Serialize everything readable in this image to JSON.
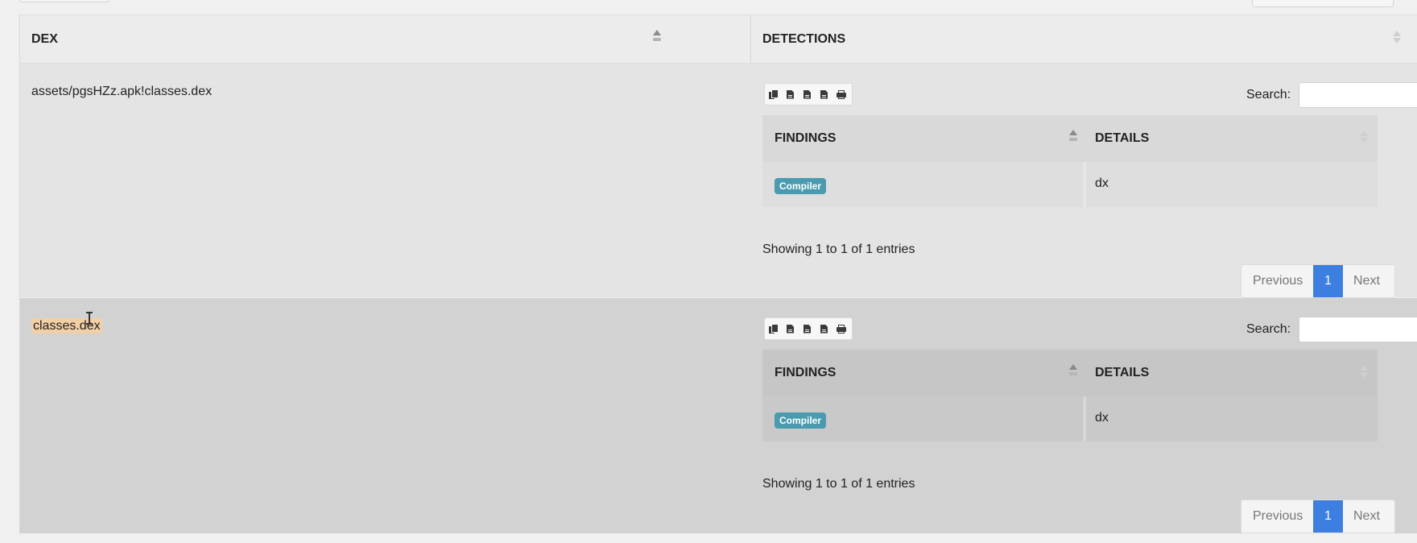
{
  "table": {
    "headers": {
      "dex": "DEX",
      "detections": "DETECTIONS"
    },
    "rows": [
      {
        "dex": "assets/pgsHZz.apk!classes.dex",
        "search_label": "Search:",
        "search_value": "",
        "findings_header": "FINDINGS",
        "details_header": "DETAILS",
        "finding_badge": "Compiler",
        "finding_detail": "dx",
        "info": "Showing 1 to 1 of 1 entries",
        "pager": {
          "previous": "Previous",
          "current": "1",
          "next": "Next"
        }
      },
      {
        "dex": "classes.dex",
        "search_label": "Search:",
        "search_value": "",
        "findings_header": "FINDINGS",
        "details_header": "DETAILS",
        "finding_badge": "Compiler",
        "finding_detail": "dx",
        "info": "Showing 1 to 1 of 1 entries",
        "pager": {
          "previous": "Previous",
          "current": "1",
          "next": "Next"
        }
      }
    ]
  },
  "toolbar_icons": [
    "copy-icon",
    "csv-icon",
    "excel-icon",
    "pdf-icon",
    "print-icon"
  ],
  "colors": {
    "badge": "#4a9bb0",
    "pager_active": "#3d7fe0",
    "row_odd": "#e4e4e4",
    "row_even": "#d2d2d2",
    "selection_highlight": "#f3cfa6"
  }
}
